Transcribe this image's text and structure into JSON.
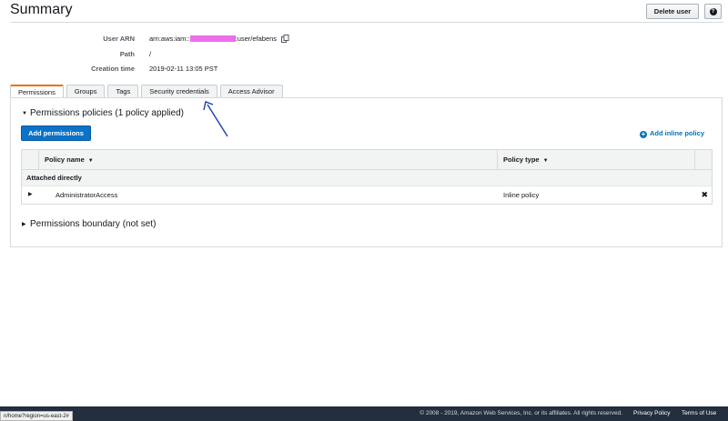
{
  "header": {
    "title": "Summary",
    "delete_label": "Delete user",
    "help_glyph": "?"
  },
  "summary": {
    "user_arn_label": "User ARN",
    "user_arn_prefix": "arn:aws:iam::",
    "user_arn_suffix": ":user/efabens",
    "path_label": "Path",
    "path_value": "/",
    "creation_label": "Creation time",
    "creation_value": "2019-02-11 13:05 PST"
  },
  "tabs": [
    {
      "label": "Permissions",
      "active": true
    },
    {
      "label": "Groups",
      "active": false
    },
    {
      "label": "Tags",
      "active": false
    },
    {
      "label": "Security credentials",
      "active": false
    },
    {
      "label": "Access Advisor",
      "active": false
    }
  ],
  "permissions": {
    "policies_heading": "Permissions policies (1 policy applied)",
    "add_permissions_label": "Add permissions",
    "add_inline_label": "Add inline policy",
    "table": {
      "col_policy_name": "Policy name",
      "col_policy_type": "Policy type",
      "group_label": "Attached directly",
      "rows": [
        {
          "name": "AdministratorAccess",
          "type": "Inline policy"
        }
      ]
    },
    "boundary_heading": "Permissions boundary (not set)"
  },
  "footer": {
    "copyright": "© 2008 - 2019, Amazon Web Services, Inc. or its affiliates. All rights reserved.",
    "privacy": "Privacy Policy",
    "terms": "Terms of Use"
  },
  "status_bar": {
    "url": "n/home?region=us-east-2#"
  },
  "colors": {
    "accent_tab": "#ec7211",
    "primary_button": "#0a73c8",
    "link": "#0073bb",
    "footer_bg": "#232f3e",
    "redaction": "#ec6eea",
    "annotation_arrow": "#1a3fb0"
  }
}
